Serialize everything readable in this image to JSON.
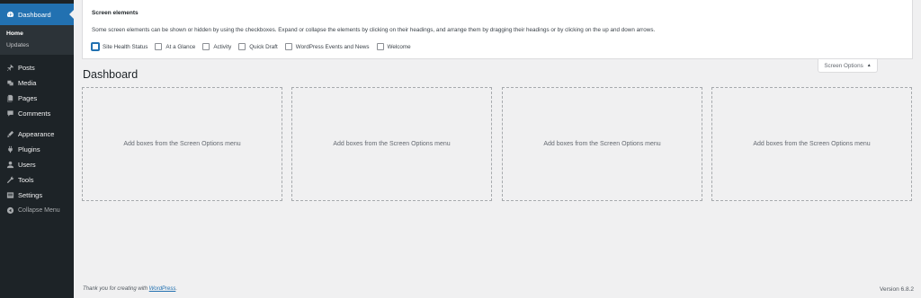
{
  "sidebar": {
    "dashboard": "Dashboard",
    "submenu": [
      "Home",
      "Updates"
    ],
    "items": [
      {
        "label": "Posts",
        "icon": "pin-icon"
      },
      {
        "label": "Media",
        "icon": "media-icon"
      },
      {
        "label": "Pages",
        "icon": "pages-icon"
      },
      {
        "label": "Comments",
        "icon": "comments-icon"
      }
    ],
    "items2": [
      {
        "label": "Appearance",
        "icon": "appearance-icon"
      },
      {
        "label": "Plugins",
        "icon": "plugins-icon"
      },
      {
        "label": "Users",
        "icon": "users-icon"
      },
      {
        "label": "Tools",
        "icon": "tools-icon"
      },
      {
        "label": "Settings",
        "icon": "settings-icon"
      }
    ],
    "collapse": "Collapse Menu"
  },
  "screen_options": {
    "heading": "Screen elements",
    "description": "Some screen elements can be shown or hidden by using the checkboxes. Expand or collapse the elements by clicking on their headings, and arrange them by dragging their headings or by clicking on the up and down arrows.",
    "checkboxes": [
      "Site Health Status",
      "At a Glance",
      "Activity",
      "Quick Draft",
      "WordPress Events and News",
      "Welcome"
    ],
    "toggle_label": "Screen Options"
  },
  "page_title": "Dashboard",
  "box_text": "Add boxes from the Screen Options menu",
  "footer": {
    "thanks_prefix": "Thank you for creating with ",
    "thanks_link": "WordPress",
    "thanks_suffix": ".",
    "version": "Version 6.8.2"
  },
  "colors": {
    "sidebar": "#1d2327",
    "accent": "#2271b1",
    "background": "#f0f0f1"
  }
}
